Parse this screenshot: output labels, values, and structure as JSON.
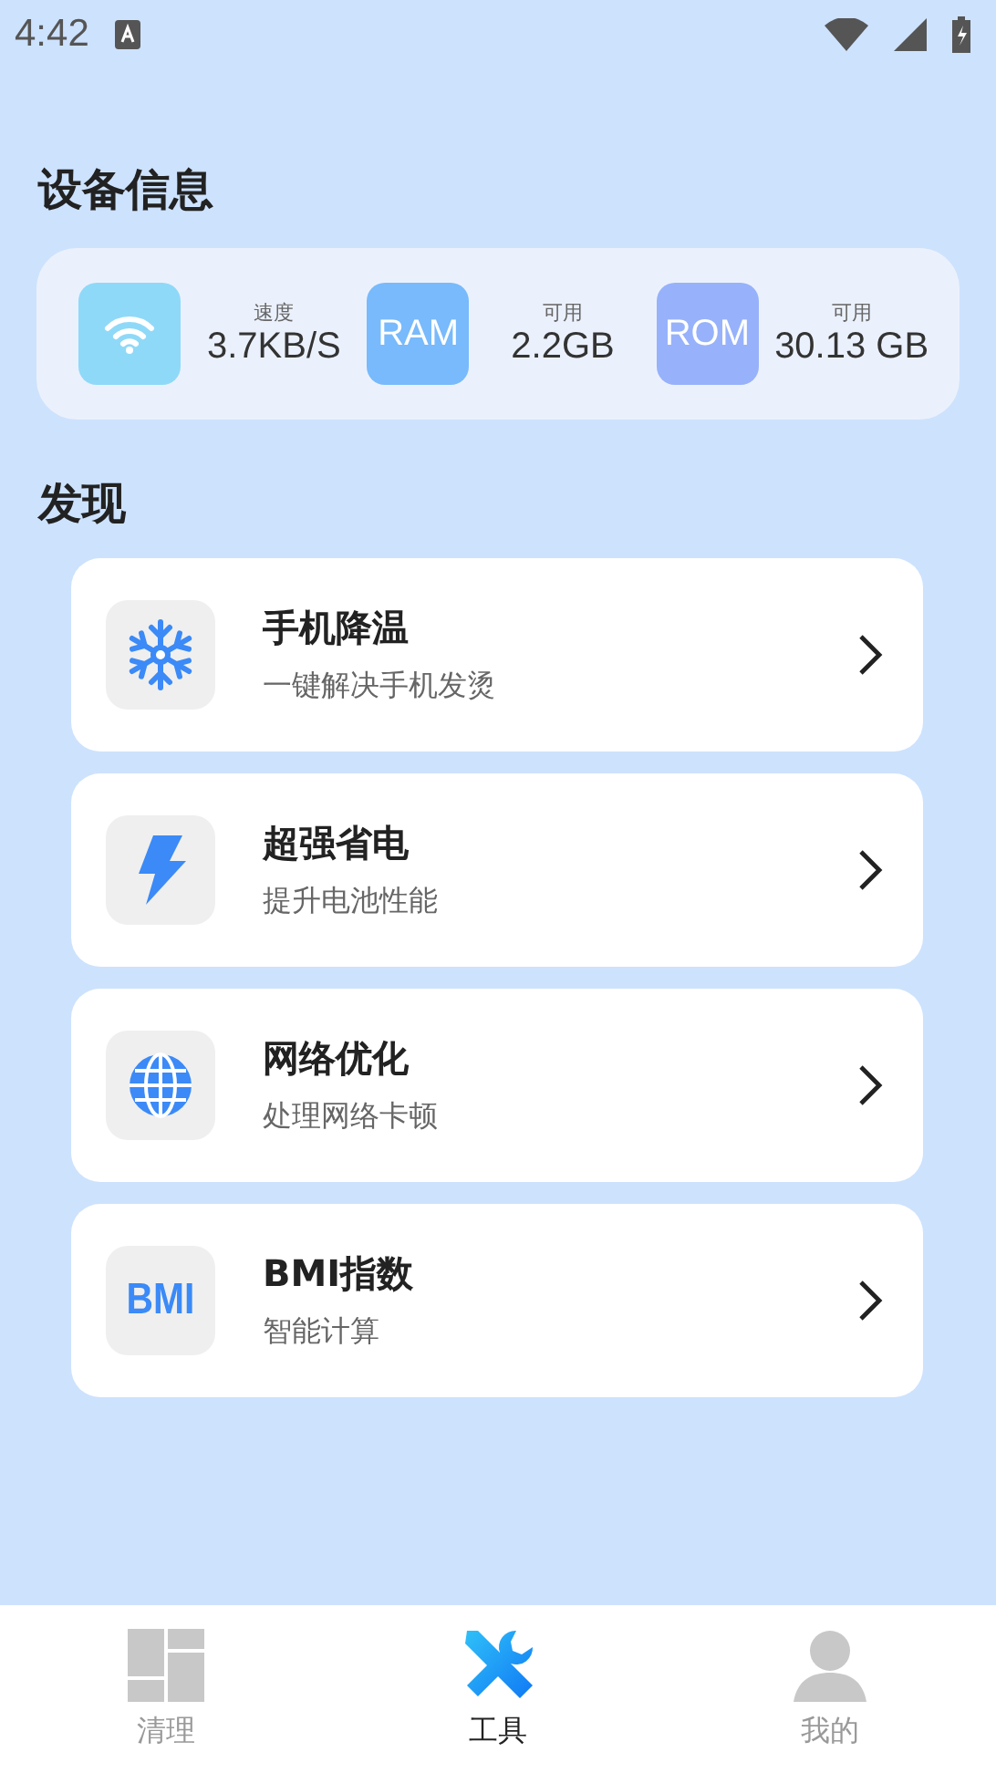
{
  "status_bar": {
    "time": "4:42"
  },
  "device_info": {
    "title": "设备信息",
    "stats": [
      {
        "kind": "wifi",
        "label": "速度",
        "value": "3.7KB/S"
      },
      {
        "kind": "ram",
        "badge": "RAM",
        "label": "可用",
        "value": "2.2GB"
      },
      {
        "kind": "rom",
        "badge": "ROM",
        "label": "可用",
        "value": "30.13 GB"
      }
    ]
  },
  "discover": {
    "title": "发现",
    "items": [
      {
        "kind": "snowflake",
        "title": "手机降温",
        "subtitle": "一键解决手机发烫"
      },
      {
        "kind": "bolt",
        "title": "超强省电",
        "subtitle": "提升电池性能"
      },
      {
        "kind": "globe",
        "title": "网络优化",
        "subtitle": "处理网络卡顿"
      },
      {
        "kind": "bmi",
        "badge": "BMI",
        "title": "BMI指数",
        "subtitle": "智能计算"
      }
    ]
  },
  "bottom_nav": [
    {
      "kind": "grid",
      "label": "清理",
      "selected": false
    },
    {
      "kind": "tools",
      "label": "工具",
      "selected": true
    },
    {
      "kind": "person",
      "label": "我的",
      "selected": false
    }
  ]
}
